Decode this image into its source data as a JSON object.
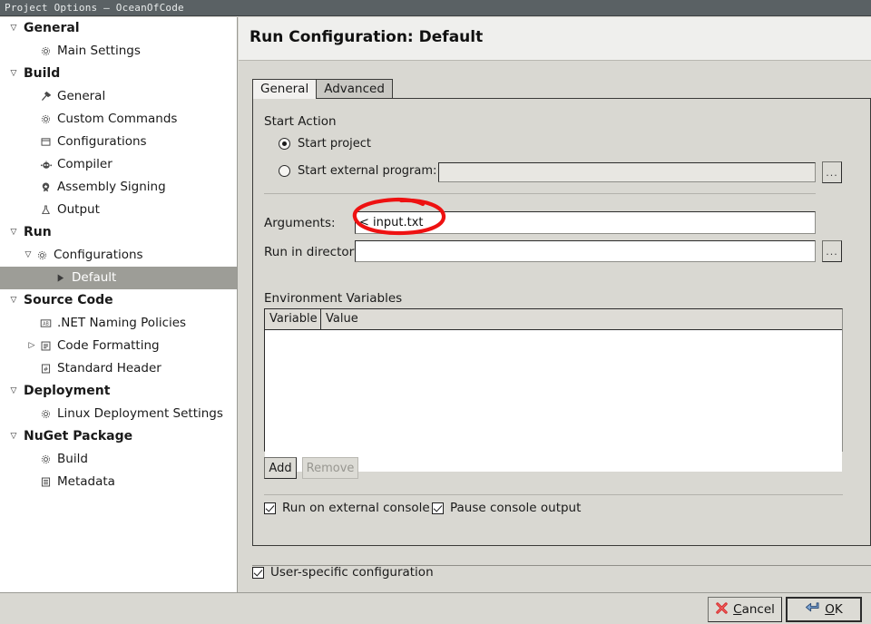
{
  "window": {
    "title": "Project Options – OceanOfCode"
  },
  "sidebar": {
    "items": [
      {
        "label": "General",
        "level": "group",
        "icon": "none",
        "twisty": "open",
        "selected": false
      },
      {
        "label": "Main Settings",
        "level": "child",
        "icon": "gear-icon",
        "twisty": "blank",
        "selected": false
      },
      {
        "label": "Build",
        "level": "group",
        "icon": "none",
        "twisty": "open",
        "selected": false
      },
      {
        "label": "General",
        "level": "child",
        "icon": "hammer-icon",
        "twisty": "blank",
        "selected": false
      },
      {
        "label": "Custom Commands",
        "level": "child",
        "icon": "gear-icon",
        "twisty": "blank",
        "selected": false
      },
      {
        "label": "Configurations",
        "level": "child",
        "icon": "window-icon",
        "twisty": "blank",
        "selected": false
      },
      {
        "label": "Compiler",
        "level": "child",
        "icon": "robot-icon",
        "twisty": "blank",
        "selected": false
      },
      {
        "label": "Assembly Signing",
        "level": "child",
        "icon": "shield-icon",
        "twisty": "blank",
        "selected": false
      },
      {
        "label": "Output",
        "level": "child",
        "icon": "flask-icon",
        "twisty": "blank",
        "selected": false
      },
      {
        "label": "Run",
        "level": "group",
        "icon": "none",
        "twisty": "open",
        "selected": false
      },
      {
        "label": "Configurations",
        "level": "sub",
        "icon": "gear-icon",
        "twisty": "open",
        "selected": false
      },
      {
        "label": "Default",
        "level": "selected",
        "icon": "play-icon",
        "twisty": "blank",
        "selected": true
      },
      {
        "label": "Source Code",
        "level": "group",
        "icon": "none",
        "twisty": "open",
        "selected": false
      },
      {
        "label": ".NET Naming Policies",
        "level": "child",
        "icon": "abc-icon",
        "twisty": "blank",
        "selected": false
      },
      {
        "label": "Code Formatting",
        "level": "child",
        "icon": "list-icon",
        "twisty": "closed",
        "selected": false
      },
      {
        "label": "Standard Header",
        "level": "child",
        "icon": "hash-icon",
        "twisty": "blank",
        "selected": false
      },
      {
        "label": "Deployment",
        "level": "group",
        "icon": "none",
        "twisty": "open",
        "selected": false
      },
      {
        "label": "Linux Deployment Settings",
        "level": "child",
        "icon": "gear-icon",
        "twisty": "blank",
        "selected": false
      },
      {
        "label": "NuGet Package",
        "level": "group",
        "icon": "none",
        "twisty": "open",
        "selected": false
      },
      {
        "label": "Build",
        "level": "child",
        "icon": "gear-icon",
        "twisty": "blank",
        "selected": false
      },
      {
        "label": "Metadata",
        "level": "child",
        "icon": "document-icon",
        "twisty": "blank",
        "selected": false
      }
    ]
  },
  "pane": {
    "title": "Run Configuration: Default",
    "tabs": [
      {
        "label": "General",
        "active": true
      },
      {
        "label": "Advanced",
        "active": false
      }
    ]
  },
  "start_action": {
    "legend": "Start Action",
    "start_project_label": "Start project",
    "start_project_selected": true,
    "start_external_label": "Start external program:",
    "start_external_selected": false,
    "start_external_value": "",
    "browse_label": "..."
  },
  "arguments": {
    "label": "Arguments:",
    "value": "< input.txt",
    "annotated": true
  },
  "run_directory": {
    "label": "Run in directory:",
    "value": "",
    "browse_label": "..."
  },
  "environment": {
    "legend": "Environment Variables",
    "columns": [
      "Variable",
      "Value"
    ],
    "rows": [],
    "add_label": "Add",
    "remove_label": "Remove",
    "remove_enabled": false
  },
  "console_options": {
    "run_external_console_label": "Run on external console",
    "run_external_console_checked": true,
    "pause_console_output_label": "Pause console output",
    "pause_console_output_checked": true
  },
  "user_specific": {
    "label": "User-specific configuration",
    "checked": true
  },
  "dialog_buttons": {
    "cancel_label": "Cancel",
    "cancel_mnemonic": "C",
    "ok_label": "OK",
    "ok_mnemonic": "O",
    "ok_focused": true
  },
  "colors": {
    "titlebar": "#5a6164",
    "dialog_bg": "#d9d8d2",
    "sidebar_bg": "#ffffff",
    "selection": "#9d9d97",
    "annotation": "#ee1111",
    "header_bg": "#efefed"
  }
}
